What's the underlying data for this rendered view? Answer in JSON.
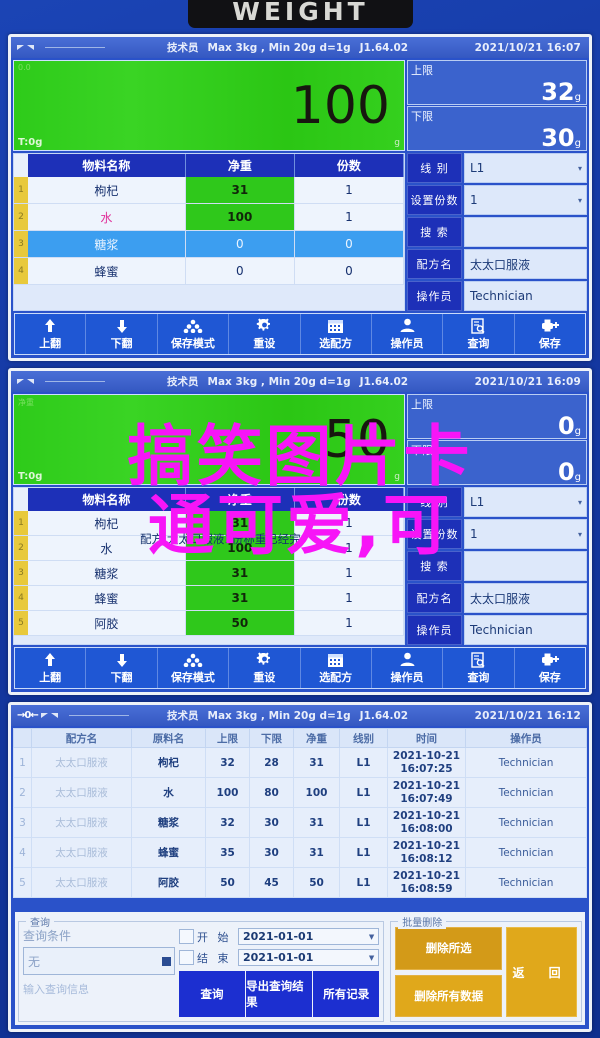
{
  "device": {
    "plate_label": "WEIGHT",
    "status": {
      "operator_role": "技术员",
      "capacity": "Max 3kg , Min 20g  d=1g",
      "firmware": "J1.64.02",
      "zero_indicator": "→0←"
    }
  },
  "panel1": {
    "time": "2021/10/21  16:07",
    "display": {
      "top_left": "0.0",
      "tare": "T:0g",
      "value": "100",
      "unit": "g"
    },
    "upper": {
      "label": "上限",
      "value": "32",
      "unit": "g"
    },
    "lower": {
      "label": "下限",
      "value": "30",
      "unit": "g"
    },
    "table": {
      "headers": [
        "物料名称",
        "净重",
        "份数"
      ],
      "rows": [
        {
          "idx": "1",
          "name": "枸杞",
          "net": "31",
          "portions": "1"
        },
        {
          "idx": "2",
          "name": "水",
          "net": "100",
          "portions": "1"
        },
        {
          "idx": "3",
          "name": "糖浆",
          "net": "0",
          "portions": "0"
        },
        {
          "idx": "4",
          "name": "蜂蜜",
          "net": "0",
          "portions": "0"
        }
      ]
    },
    "controls": [
      {
        "label": "线  别",
        "value": "L1",
        "dropdown": true
      },
      {
        "label": "设置份数",
        "value": "1",
        "dropdown": true
      },
      {
        "label": "搜  索",
        "value": "",
        "dropdown": false
      },
      {
        "label": "配方名",
        "value": "太太口服液",
        "dropdown": false
      },
      {
        "label": "操作员",
        "value": "Technician",
        "dropdown": false
      }
    ]
  },
  "panel2": {
    "time": "2021/10/21  16:09",
    "display": {
      "top_left": "净重",
      "tare": "T:0g",
      "value": "50",
      "unit": "g"
    },
    "upper": {
      "label": "上限",
      "value": "0",
      "unit": "g"
    },
    "lower": {
      "label": "下限",
      "value": "0",
      "unit": "g"
    },
    "dialog_message": "配方:太太口服液1份称重已经完",
    "table": {
      "headers": [
        "物料名称",
        "净重",
        "份数"
      ],
      "rows": [
        {
          "idx": "1",
          "name": "枸杞",
          "net": "31",
          "portions": "1"
        },
        {
          "idx": "2",
          "name": "水",
          "net": "100",
          "portions": "1"
        },
        {
          "idx": "3",
          "name": "糖浆",
          "net": "31",
          "portions": "1"
        },
        {
          "idx": "4",
          "name": "蜂蜜",
          "net": "31",
          "portions": "1"
        },
        {
          "idx": "5",
          "name": "阿胶",
          "net": "50",
          "portions": "1"
        }
      ]
    },
    "controls": [
      {
        "label": "线  别",
        "value": "L1",
        "dropdown": true
      },
      {
        "label": "设置份数",
        "value": "1",
        "dropdown": true
      },
      {
        "label": "搜  索",
        "value": "",
        "dropdown": false
      },
      {
        "label": "配方名",
        "value": "太太口服液",
        "dropdown": false
      },
      {
        "label": "操作员",
        "value": "Technician",
        "dropdown": false
      }
    ]
  },
  "toolbar": {
    "buttons": [
      {
        "label": "上翻",
        "icon": "arrow-up-icon"
      },
      {
        "label": "下翻",
        "icon": "arrow-down-icon"
      },
      {
        "label": "保存模式",
        "icon": "stack-icon"
      },
      {
        "label": "重设",
        "icon": "gear-icon"
      },
      {
        "label": "选配方",
        "icon": "calendar-icon"
      },
      {
        "label": "操作员",
        "icon": "user-icon"
      },
      {
        "label": "查询",
        "icon": "document-search-icon"
      },
      {
        "label": "保存",
        "icon": "save-plus-icon"
      }
    ]
  },
  "panel3": {
    "time": "2021/10/21  16:12",
    "table": {
      "headers": [
        "配方名",
        "原料名",
        "上限",
        "下限",
        "净重",
        "线别",
        "时间",
        "操作员"
      ],
      "rows": [
        {
          "idx": "1",
          "recipe": "太太口服液",
          "material": "枸杞",
          "upper": "32",
          "lower": "28",
          "net": "31",
          "line": "L1",
          "date": "2021-10-21",
          "time": "16:07:25",
          "operator": "Technician"
        },
        {
          "idx": "2",
          "recipe": "太太口服液",
          "material": "水",
          "upper": "100",
          "lower": "80",
          "net": "100",
          "line": "L1",
          "date": "2021-10-21",
          "time": "16:07:49",
          "operator": "Technician"
        },
        {
          "idx": "3",
          "recipe": "太太口服液",
          "material": "糖浆",
          "upper": "32",
          "lower": "30",
          "net": "31",
          "line": "L1",
          "date": "2021-10-21",
          "time": "16:08:00",
          "operator": "Technician"
        },
        {
          "idx": "4",
          "recipe": "太太口服液",
          "material": "蜂蜜",
          "upper": "35",
          "lower": "30",
          "net": "31",
          "line": "L1",
          "date": "2021-10-21",
          "time": "16:08:12",
          "operator": "Technician"
        },
        {
          "idx": "5",
          "recipe": "太太口服液",
          "material": "阿胶",
          "upper": "50",
          "lower": "45",
          "net": "50",
          "line": "L1",
          "date": "2021-10-21",
          "time": "16:08:59",
          "operator": "Technician"
        }
      ]
    },
    "query": {
      "group_title": "查询",
      "condition_label": "查询条件",
      "condition_value": "无",
      "condition_hint": "输入查询信息",
      "start_label": "开  始",
      "start_date": "2021-01-01",
      "end_label": "结  束",
      "end_date": "2021-01-01",
      "btn_query": "查询",
      "btn_export": "导出查询结果",
      "btn_all": "所有记录"
    },
    "batch_delete": {
      "group_title": "批量删除",
      "btn_delete_selected": "删除所选",
      "btn_delete_all": "删除所有数据",
      "btn_return": "返 回"
    }
  },
  "watermark": {
    "line1": "搞笑图片卡",
    "line2": "通可爱,可"
  }
}
